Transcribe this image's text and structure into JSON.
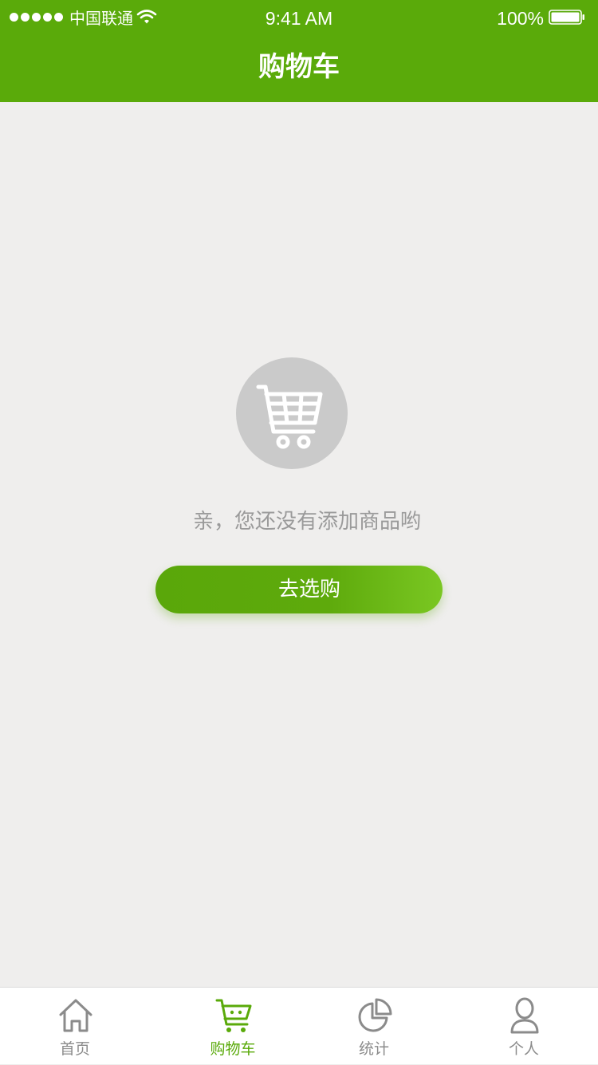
{
  "status_bar": {
    "carrier": "中国联通",
    "time": "9:41 AM",
    "battery": "100%"
  },
  "header": {
    "title": "购物车"
  },
  "empty_state": {
    "icon": "shopping-cart-icon",
    "message": "亲，您还没有添加商品哟",
    "button_label": "去选购"
  },
  "tabbar": {
    "items": [
      {
        "label": "首页",
        "icon": "home-icon",
        "active": false
      },
      {
        "label": "购物车",
        "icon": "cart-icon",
        "active": true
      },
      {
        "label": "统计",
        "icon": "pie-chart-icon",
        "active": false
      },
      {
        "label": "个人",
        "icon": "person-icon",
        "active": false
      }
    ]
  },
  "colors": {
    "brand": "#5aaa0a",
    "button_gradient_end": "#7ac722",
    "background": "#efeeed",
    "tab_inactive": "#8b8b8b",
    "empty_icon_bg": "#cacaca",
    "empty_text": "#9a9a9a"
  }
}
